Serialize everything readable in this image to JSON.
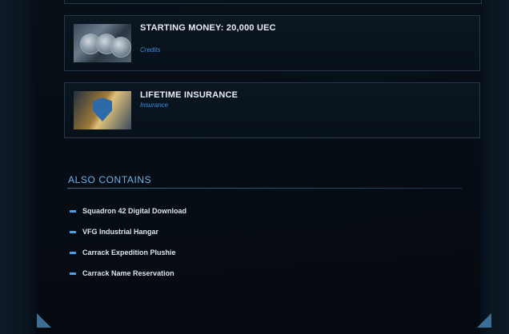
{
  "items": [
    {
      "title": "STARTING MONEY: 20,000 UEC",
      "subtitle": "Credits",
      "icon": "coins-icon"
    },
    {
      "title": "LIFETIME INSURANCE",
      "subtitle": "Insurance",
      "icon": "shield-icon"
    }
  ],
  "also_contains": {
    "heading": "ALSO CONTAINS",
    "items": [
      "Squadron 42 Digital Download",
      "VFG Industrial Hangar",
      "Carrack Expedition Plushie",
      "Carrack Name Reservation"
    ]
  },
  "colors": {
    "accent": "#6fb3ea",
    "subtitle": "#3c8de0",
    "bullet": "#4aa0e6",
    "background": "#05090f"
  }
}
